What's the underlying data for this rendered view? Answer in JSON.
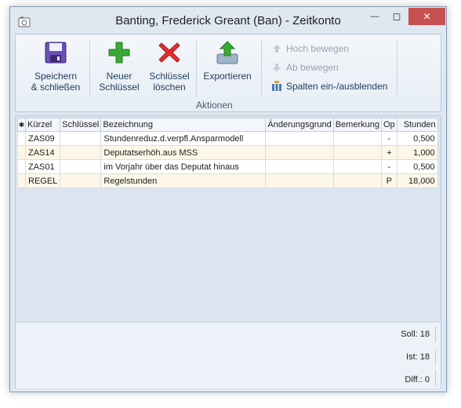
{
  "window": {
    "title": "Banting, Frederick Greant (Ban) - Zeitkonto",
    "minimize_glyph": "—",
    "maximize_glyph": "◻",
    "close_glyph": "✕"
  },
  "ribbon": {
    "save_label": "Speichern\n& schließen",
    "new_key_label": "Neuer\nSchlüssel",
    "delete_key_label": "Schlüssel\nlöschen",
    "export_label": "Exportieren",
    "move_up_label": "Hoch bewegen",
    "move_down_label": "Ab bewegen",
    "columns_label": "Spalten ein-/ausblenden",
    "group_label": "Aktionen"
  },
  "grid": {
    "indicator_glyph": "✱",
    "headers": [
      "Kürzel",
      "Schlüssel",
      "Bezeichnung",
      "Änderungsgrund",
      "Bemerkung",
      "Op",
      "Stunden"
    ],
    "rows": [
      {
        "kuerzel": "ZAS09",
        "schluessel": "",
        "bezeichnung": "Stundenreduz.d.verpfl.Ansparmodell",
        "aenderungsgrund": "",
        "bemerkung": "",
        "op": "-",
        "stunden": "0,500"
      },
      {
        "kuerzel": "ZAS14",
        "schluessel": "",
        "bezeichnung": "Deputatserhöh.aus MSS",
        "aenderungsgrund": "",
        "bemerkung": "",
        "op": "+",
        "stunden": "1,000"
      },
      {
        "kuerzel": "ZAS01",
        "schluessel": "",
        "bezeichnung": "im Vorjahr über das Deputat hinaus",
        "aenderungsgrund": "",
        "bemerkung": "",
        "op": "-",
        "stunden": "0,500"
      },
      {
        "kuerzel": "REGEL",
        "schluessel": "",
        "bezeichnung": "Regelstunden",
        "aenderungsgrund": "",
        "bemerkung": "",
        "op": "P",
        "stunden": "18,000"
      }
    ]
  },
  "summary": {
    "soll": "Soll: 18",
    "ist": "Ist: 18",
    "diff": "Diff.: 0"
  },
  "colors": {
    "accent": "#1f3b5a",
    "close_button": "#c75050",
    "row_highlight": "#fdf7e8"
  }
}
